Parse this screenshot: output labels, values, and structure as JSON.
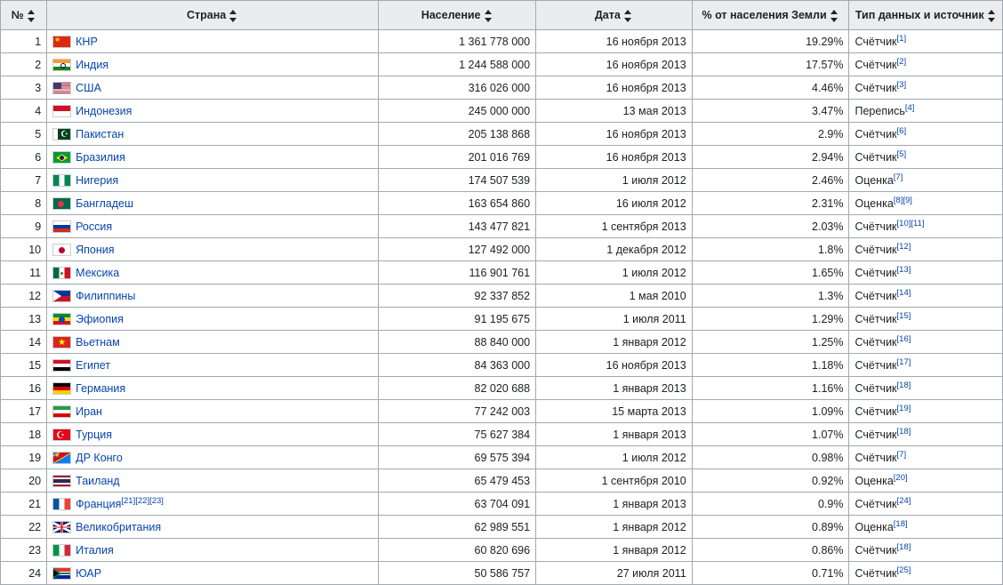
{
  "headers": {
    "num": "№",
    "country": "Страна",
    "population": "Население",
    "date": "Дата",
    "percent": "% от населения Земли",
    "source": "Тип данных и источник"
  },
  "rows": [
    {
      "n": "1",
      "flag": "cn",
      "country": "КНР",
      "crefs": [],
      "pop": "1 361 778 000",
      "date": "16 ноября 2013",
      "pct": "19.29%",
      "src": "Счётчик",
      "refs": [
        "[1]"
      ]
    },
    {
      "n": "2",
      "flag": "in",
      "country": "Индия",
      "crefs": [],
      "pop": "1 244 588 000",
      "date": "16 ноября 2013",
      "pct": "17.57%",
      "src": "Счётчик",
      "refs": [
        "[2]"
      ]
    },
    {
      "n": "3",
      "flag": "us",
      "country": "США",
      "crefs": [],
      "pop": "316 026 000",
      "date": "16 ноября 2013",
      "pct": "4.46%",
      "src": "Счётчик",
      "refs": [
        "[3]"
      ]
    },
    {
      "n": "4",
      "flag": "id",
      "country": "Индонезия",
      "crefs": [],
      "pop": "245 000 000",
      "date": "13 мая 2013",
      "pct": "3.47%",
      "src": "Перепись",
      "refs": [
        "[4]"
      ]
    },
    {
      "n": "5",
      "flag": "pk",
      "country": "Пакистан",
      "crefs": [],
      "pop": "205 138 868",
      "date": "16 ноября 2013",
      "pct": "2.9%",
      "src": "Счётчик",
      "refs": [
        "[6]"
      ]
    },
    {
      "n": "6",
      "flag": "br",
      "country": "Бразилия",
      "crefs": [],
      "pop": "201 016 769",
      "date": "16 ноября 2013",
      "pct": "2.94%",
      "src": "Счётчик",
      "refs": [
        "[5]"
      ]
    },
    {
      "n": "7",
      "flag": "ng",
      "country": "Нигерия",
      "crefs": [],
      "pop": "174 507 539",
      "date": "1 июля 2012",
      "pct": "2.46%",
      "src": "Оценка",
      "refs": [
        "[7]"
      ]
    },
    {
      "n": "8",
      "flag": "bd",
      "country": "Бангладеш",
      "crefs": [],
      "pop": "163 654 860",
      "date": "16 июля 2012",
      "pct": "2.31%",
      "src": "Оценка",
      "refs": [
        "[8]",
        "[9]"
      ]
    },
    {
      "n": "9",
      "flag": "ru",
      "country": "Россия",
      "crefs": [],
      "pop": "143 477 821",
      "date": "1 сентября 2013",
      "pct": "2.03%",
      "src": "Счётчик",
      "refs": [
        "[10]",
        "[11]"
      ]
    },
    {
      "n": "10",
      "flag": "jp",
      "country": "Япония",
      "crefs": [],
      "pop": "127 492 000",
      "date": "1 декабря 2012",
      "pct": "1.8%",
      "src": "Счётчик",
      "refs": [
        "[12]"
      ]
    },
    {
      "n": "11",
      "flag": "mx",
      "country": "Мексика",
      "crefs": [],
      "pop": "116 901 761",
      "date": "1 июля 2012",
      "pct": "1.65%",
      "src": "Счётчик",
      "refs": [
        "[13]"
      ]
    },
    {
      "n": "12",
      "flag": "ph",
      "country": "Филиппины",
      "crefs": [],
      "pop": "92 337 852",
      "date": "1 мая 2010",
      "pct": "1.3%",
      "src": "Счётчик",
      "refs": [
        "[14]"
      ]
    },
    {
      "n": "13",
      "flag": "et",
      "country": "Эфиопия",
      "crefs": [],
      "pop": "91 195 675",
      "date": "1 июля 2011",
      "pct": "1.29%",
      "src": "Счётчик",
      "refs": [
        "[15]"
      ]
    },
    {
      "n": "14",
      "flag": "vn",
      "country": "Вьетнам",
      "crefs": [],
      "pop": "88 840 000",
      "date": "1 января 2012",
      "pct": "1.25%",
      "src": "Счётчик",
      "refs": [
        "[16]"
      ]
    },
    {
      "n": "15",
      "flag": "eg",
      "country": "Египет",
      "crefs": [],
      "pop": "84 363 000",
      "date": "16 ноября 2013",
      "pct": "1.18%",
      "src": "Счётчик",
      "refs": [
        "[17]"
      ]
    },
    {
      "n": "16",
      "flag": "de",
      "country": "Германия",
      "crefs": [],
      "pop": "82 020 688",
      "date": "1 января 2013",
      "pct": "1.16%",
      "src": "Счётчик",
      "refs": [
        "[18]"
      ]
    },
    {
      "n": "17",
      "flag": "ir",
      "country": "Иран",
      "crefs": [],
      "pop": "77 242 003",
      "date": "15 марта 2013",
      "pct": "1.09%",
      "src": "Счётчик",
      "refs": [
        "[19]"
      ]
    },
    {
      "n": "18",
      "flag": "tr",
      "country": "Турция",
      "crefs": [],
      "pop": "75 627 384",
      "date": "1 января 2013",
      "pct": "1.07%",
      "src": "Счётчик",
      "refs": [
        "[18]"
      ]
    },
    {
      "n": "19",
      "flag": "cd",
      "country": "ДР Конго",
      "crefs": [],
      "pop": "69 575 394",
      "date": "1 июля 2012",
      "pct": "0.98%",
      "src": "Счётчик",
      "refs": [
        "[7]"
      ]
    },
    {
      "n": "20",
      "flag": "th",
      "country": "Таиланд",
      "crefs": [],
      "pop": "65 479 453",
      "date": "1 сентября 2010",
      "pct": "0.92%",
      "src": "Оценка",
      "refs": [
        "[20]"
      ]
    },
    {
      "n": "21",
      "flag": "fr",
      "country": "Франция",
      "crefs": [
        "[21]",
        "[22]",
        "[23]"
      ],
      "pop": "63 704 091",
      "date": "1 января 2013",
      "pct": "0.9%",
      "src": "Счётчик",
      "refs": [
        "[24]"
      ]
    },
    {
      "n": "22",
      "flag": "gb",
      "country": "Великобритания",
      "crefs": [],
      "pop": "62 989 551",
      "date": "1 января 2012",
      "pct": "0.89%",
      "src": "Оценка",
      "refs": [
        "[18]"
      ]
    },
    {
      "n": "23",
      "flag": "it",
      "country": "Италия",
      "crefs": [],
      "pop": "60 820 696",
      "date": "1 января 2012",
      "pct": "0.86%",
      "src": "Счётчик",
      "refs": [
        "[18]"
      ]
    },
    {
      "n": "24",
      "flag": "za",
      "country": "ЮАР",
      "crefs": [],
      "pop": "50 586 757",
      "date": "27 июля 2011",
      "pct": "0.71%",
      "src": "Счётчик",
      "refs": [
        "[25]"
      ]
    }
  ]
}
